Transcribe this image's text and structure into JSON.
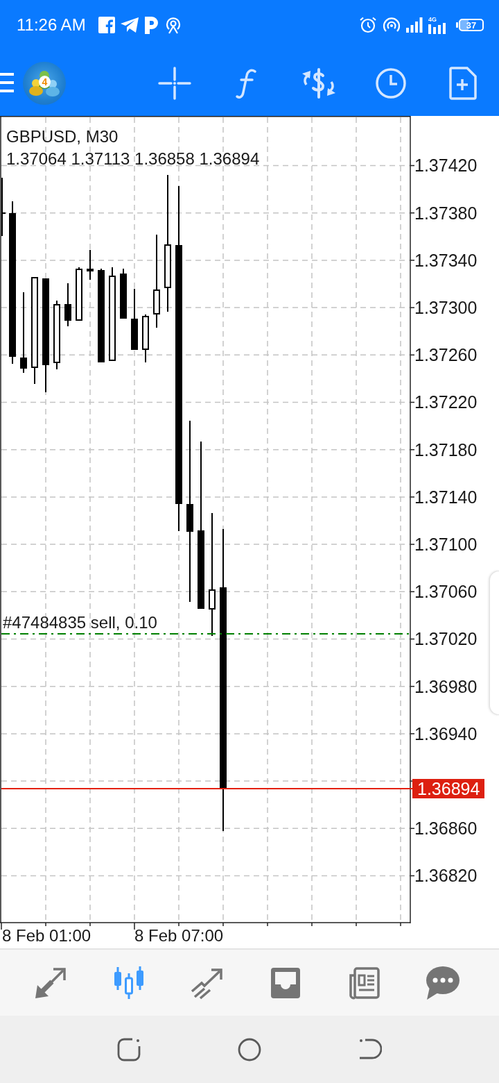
{
  "status_bar": {
    "time": "11:26 AM",
    "network_type": "4G",
    "battery": "37"
  },
  "toolbar": {
    "logo_badge": "4"
  },
  "chart": {
    "symbol": "GBPUSD, M30",
    "ohlc": "1.37064 1.37113 1.36858 1.36894",
    "order_label": "#47484835 sell, 0.10",
    "price_axis": [
      {
        "kind": "tick",
        "label": "1.37420"
      },
      {
        "kind": "tick",
        "label": "1.37380"
      },
      {
        "kind": "tick",
        "label": "1.37340"
      },
      {
        "kind": "tick",
        "label": "1.37300"
      },
      {
        "kind": "tick",
        "label": "1.37260"
      },
      {
        "kind": "tick",
        "label": "1.37220"
      },
      {
        "kind": "tick",
        "label": "1.37180"
      },
      {
        "kind": "tick",
        "label": "1.37140"
      },
      {
        "kind": "tick",
        "label": "1.37100"
      },
      {
        "kind": "tick",
        "label": "1.37060"
      },
      {
        "kind": "tick",
        "label": "1.37020"
      },
      {
        "kind": "tick",
        "label": "1.36980"
      },
      {
        "kind": "tick",
        "label": "1.36940"
      },
      {
        "kind": "current",
        "label": "1.36894"
      },
      {
        "kind": "tick",
        "label": "1.36860"
      },
      {
        "kind": "tick",
        "label": "1.36820"
      }
    ],
    "time_axis": [
      "8 Feb 01:00",
      "8 Feb 07:00"
    ]
  },
  "bottom_nav": {
    "items": [
      {
        "selected": false
      },
      {
        "selected": true
      },
      {
        "selected": false
      },
      {
        "selected": false
      },
      {
        "selected": false
      },
      {
        "selected": false
      }
    ]
  }
}
